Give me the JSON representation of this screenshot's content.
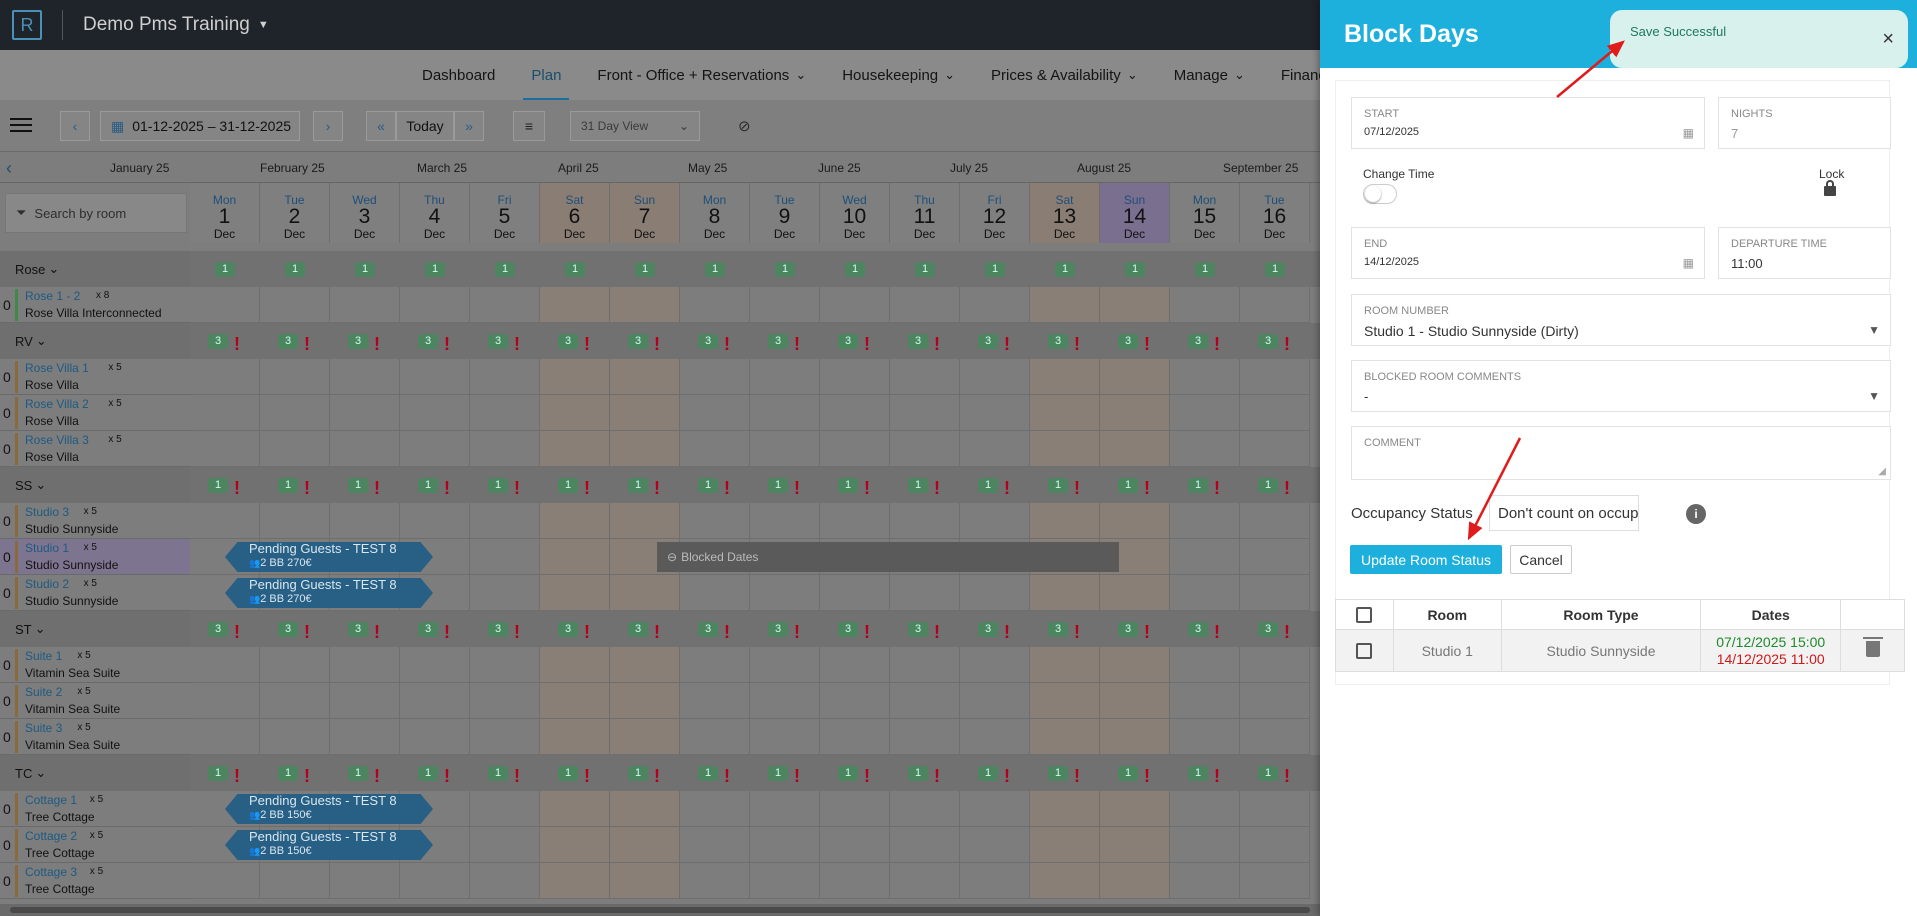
{
  "header": {
    "app_title": "Demo Pms Training",
    "logo_letter": "R"
  },
  "nav": {
    "items": [
      {
        "label": "Dashboard"
      },
      {
        "label": "Plan"
      },
      {
        "label": "Front - Office + Reservations"
      },
      {
        "label": "Housekeeping"
      },
      {
        "label": "Prices & Availability"
      },
      {
        "label": "Manage"
      },
      {
        "label": "Finance"
      }
    ]
  },
  "toolbar": {
    "date_range": "01-12-2025 – 31-12-2025",
    "today_label": "Today",
    "view_select": "31 Day View"
  },
  "months": [
    "January 25",
    "February 25",
    "March 25",
    "April 25",
    "May 25",
    "June 25",
    "July 25",
    "August 25",
    "September 25"
  ],
  "search": {
    "placeholder": "Search by room"
  },
  "days": [
    {
      "name": "Mon",
      "num": "1",
      "mon": "Dec"
    },
    {
      "name": "Tue",
      "num": "2",
      "mon": "Dec"
    },
    {
      "name": "Wed",
      "num": "3",
      "mon": "Dec"
    },
    {
      "name": "Thu",
      "num": "4",
      "mon": "Dec"
    },
    {
      "name": "Fri",
      "num": "5",
      "mon": "Dec"
    },
    {
      "name": "Sat",
      "num": "6",
      "mon": "Dec"
    },
    {
      "name": "Sun",
      "num": "7",
      "mon": "Dec"
    },
    {
      "name": "Mon",
      "num": "8",
      "mon": "Dec"
    },
    {
      "name": "Tue",
      "num": "9",
      "mon": "Dec"
    },
    {
      "name": "Wed",
      "num": "10",
      "mon": "Dec"
    },
    {
      "name": "Thu",
      "num": "11",
      "mon": "Dec"
    },
    {
      "name": "Fri",
      "num": "12",
      "mon": "Dec"
    },
    {
      "name": "Sat",
      "num": "13",
      "mon": "Dec"
    },
    {
      "name": "Sun",
      "num": "14",
      "mon": "Dec"
    },
    {
      "name": "Mon",
      "num": "15",
      "mon": "Dec"
    },
    {
      "name": "Tue",
      "num": "16",
      "mon": "Dec"
    }
  ],
  "groups": [
    {
      "label": "Rose",
      "badge": "1",
      "alert": false,
      "rooms": [
        {
          "name": "Rose 1 - 2",
          "cap": "x 8",
          "type": "Rose Villa Interconnected",
          "count": "0"
        }
      ]
    },
    {
      "label": "RV",
      "badge": "3",
      "alert": true,
      "rooms": [
        {
          "name": "Rose Villa 1",
          "cap": "x 5",
          "type": "Rose Villa",
          "count": "0"
        },
        {
          "name": "Rose Villa 2",
          "cap": "x 5",
          "type": "Rose Villa",
          "count": "0"
        },
        {
          "name": "Rose Villa 3",
          "cap": "x 5",
          "type": "Rose Villa",
          "count": "0"
        }
      ]
    },
    {
      "label": "SS",
      "badge": "1",
      "alert": true,
      "rooms": [
        {
          "name": "Studio 3",
          "cap": "x 5",
          "type": "Studio Sunnyside",
          "count": "0"
        },
        {
          "name": "Studio 1",
          "cap": "x 5",
          "type": "Studio Sunnyside",
          "count": "0"
        },
        {
          "name": "Studio 2",
          "cap": "x 5",
          "type": "Studio Sunnyside",
          "count": "0"
        }
      ]
    },
    {
      "label": "ST",
      "badge": "3",
      "alert": true,
      "rooms": [
        {
          "name": "Suite 1",
          "cap": "x 5",
          "type": "Vitamin Sea Suite",
          "count": "0"
        },
        {
          "name": "Suite 2",
          "cap": "x 5",
          "type": "Vitamin Sea Suite",
          "count": "0"
        },
        {
          "name": "Suite 3",
          "cap": "x 5",
          "type": "Vitamin Sea Suite",
          "count": "0"
        }
      ]
    },
    {
      "label": "TC",
      "badge": "1",
      "alert": true,
      "rooms": [
        {
          "name": "Cottage 1",
          "cap": "x 5",
          "type": "Tree Cottage",
          "count": "0"
        },
        {
          "name": "Cottage 2",
          "cap": "x 5",
          "type": "Tree Cottage",
          "count": "0"
        },
        {
          "name": "Cottage 3",
          "cap": "x 5",
          "type": "Tree Cottage",
          "count": "0"
        }
      ]
    }
  ],
  "bookings": {
    "title": "Pending Guests - TEST 8",
    "guests": "2",
    "board": "BB",
    "price_studio": "270€",
    "price_cottage": "150€"
  },
  "blocked_label": "Blocked Dates",
  "panel": {
    "title": "Block Days",
    "toast": "Save Successful",
    "start_label": "START",
    "start_value": "07/12/2025",
    "nights_label": "NIGHTS",
    "nights_value": "7",
    "change_time_label": "Change Time",
    "lock_label": "Lock",
    "end_label": "END",
    "end_value": "14/12/2025",
    "departure_label": "DEPARTURE TIME",
    "departure_value": "11:00",
    "room_number_label": "ROOM NUMBER",
    "room_number_value": "Studio 1 - Studio Sunnyside (Dirty)",
    "blocked_comments_label": "BLOCKED ROOM COMMENTS",
    "blocked_comments_value": "-",
    "comment_label": "COMMENT",
    "occupancy_label": "Occupancy Status",
    "occupancy_value": "Don't count on occupa...",
    "update_button": "Update Room Status",
    "cancel_button": "Cancel",
    "table": {
      "headers": [
        "Room",
        "Room Type",
        "Dates"
      ],
      "rows": [
        {
          "room": "Studio 1",
          "type": "Studio Sunnyside",
          "start": "07/12/2025 15:00",
          "end": "14/12/2025 11:00"
        }
      ]
    }
  },
  "colors": {
    "accent": "#1eb0dd",
    "start_date": "#1e8a2e",
    "end_date": "#d01818",
    "annotation_arrow": "#e01b1b"
  }
}
